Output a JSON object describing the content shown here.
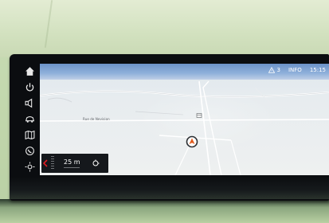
{
  "status": {
    "warning_count": "3",
    "info_label": "INFO",
    "time": "15:15"
  },
  "map": {
    "street_label": "Rue de Nevision",
    "poi_icon": "building-icon",
    "vehicle_icon": "vehicle-position-icon"
  },
  "rail": {
    "items": [
      {
        "icon": "home-icon"
      },
      {
        "icon": "power-icon"
      },
      {
        "icon": "media-speaker-icon"
      },
      {
        "icon": "car-icon"
      },
      {
        "icon": "map-book-icon"
      },
      {
        "icon": "phone-icon"
      },
      {
        "icon": "settings-sun-icon"
      }
    ]
  },
  "guidance": {
    "distance": "25 m",
    "turn_icon": "roundabout-icon"
  },
  "colors": {
    "accent_red": "#e11b22",
    "panel": "#15181c",
    "sky": "#6c93c9"
  }
}
